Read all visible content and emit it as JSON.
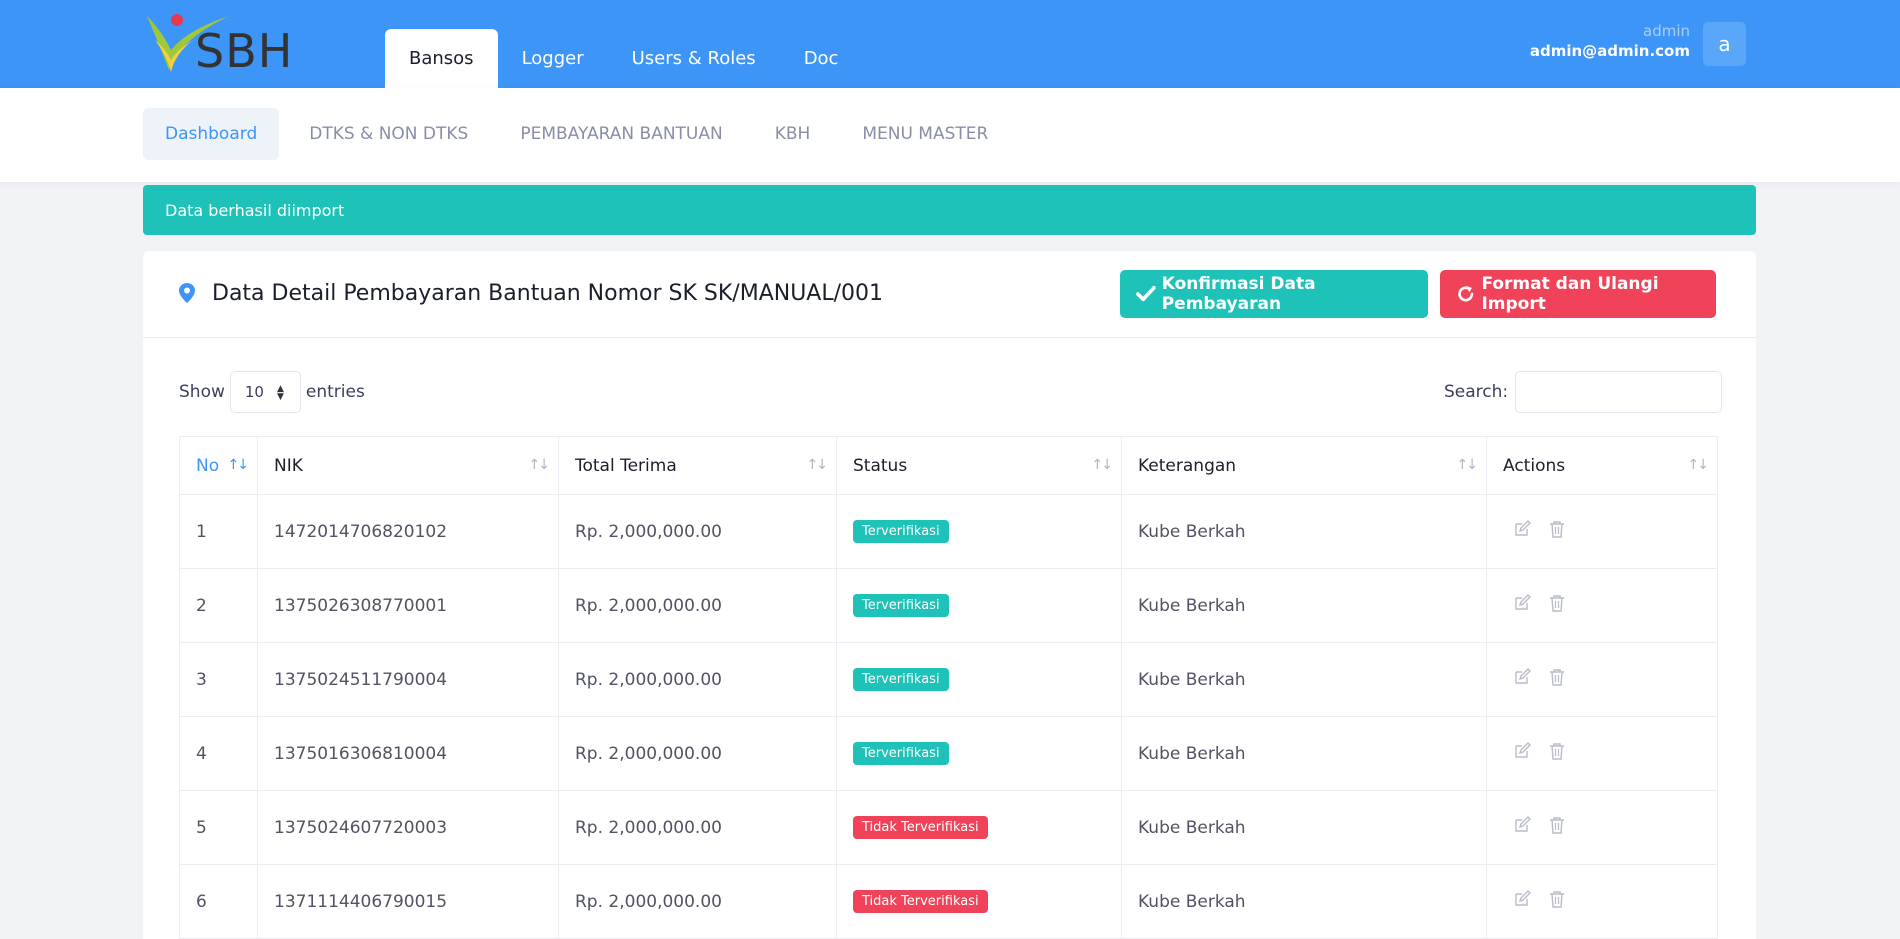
{
  "brand": {
    "logo_text": "SBH"
  },
  "main_tabs": [
    {
      "label": "Bansos",
      "active": true
    },
    {
      "label": "Logger",
      "active": false
    },
    {
      "label": "Users & Roles",
      "active": false
    },
    {
      "label": "Doc",
      "active": false
    }
  ],
  "user": {
    "role": "admin",
    "email": "admin@admin.com",
    "avatar_letter": "a"
  },
  "sub_nav": [
    {
      "label": "Dashboard",
      "active": true
    },
    {
      "label": "DTKS & NON DTKS",
      "active": false
    },
    {
      "label": "PEMBAYARAN BANTUAN",
      "active": false
    },
    {
      "label": "KBH",
      "active": false
    },
    {
      "label": "MENU MASTER",
      "active": false
    }
  ],
  "alert": {
    "text": "Data berhasil diimport"
  },
  "card": {
    "title": "Data Detail Pembayaran Bantuan Nomor SK SK/MANUAL/001",
    "confirm_button": "Konfirmasi Data Pembayaran",
    "reset_button": "Format dan Ulangi Import"
  },
  "table_controls": {
    "show_label": "Show",
    "entries_value": "10",
    "entries_label": "entries",
    "search_label": "Search:"
  },
  "table": {
    "columns": [
      "No",
      "NIK",
      "Total Terima",
      "Status",
      "Keterangan",
      "Actions"
    ],
    "rows": [
      {
        "no": "1",
        "nik": "1472014706820102",
        "total": "Rp. 2,000,000.00",
        "status": "Terverifikasi",
        "verified": true,
        "keterangan": "Kube Berkah"
      },
      {
        "no": "2",
        "nik": "1375026308770001",
        "total": "Rp. 2,000,000.00",
        "status": "Terverifikasi",
        "verified": true,
        "keterangan": "Kube Berkah"
      },
      {
        "no": "3",
        "nik": "1375024511790004",
        "total": "Rp. 2,000,000.00",
        "status": "Terverifikasi",
        "verified": true,
        "keterangan": "Kube Berkah"
      },
      {
        "no": "4",
        "nik": "1375016306810004",
        "total": "Rp. 2,000,000.00",
        "status": "Terverifikasi",
        "verified": true,
        "keterangan": "Kube Berkah"
      },
      {
        "no": "5",
        "nik": "1375024607720003",
        "total": "Rp. 2,000,000.00",
        "status": "Tidak Terverifikasi",
        "verified": false,
        "keterangan": "Kube Berkah"
      },
      {
        "no": "6",
        "nik": "1371114406790015",
        "total": "Rp. 2,000,000.00",
        "status": "Tidak Terverifikasi",
        "verified": false,
        "keterangan": "Kube Berkah"
      }
    ]
  },
  "colors": {
    "primary": "#3d95f7",
    "success": "#1fc2b8",
    "danger": "#f0435a"
  }
}
